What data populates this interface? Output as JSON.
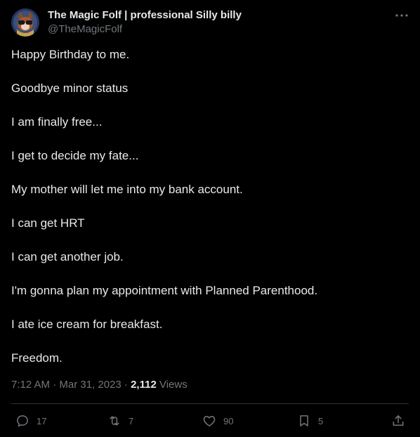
{
  "author": {
    "name": "The Magic Folf | professional Silly billy",
    "handle": "@TheMagicFolf"
  },
  "tweet": {
    "lines": [
      "Happy Birthday to me.",
      "Goodbye minor status",
      "I am finally free...",
      "I get to decide my fate...",
      "My mother will let me into my bank account.",
      "I can get HRT",
      "I can get another job.",
      "I'm gonna plan my appointment with Planned Parenthood.",
      "I ate ice cream for breakfast.",
      "Freedom."
    ],
    "timestamp": "7:12 AM · Mar 31, 2023 · ",
    "views_count": "2,112",
    "views_label": " Views"
  },
  "actions": {
    "replies": "17",
    "reposts": "7",
    "likes": "90",
    "bookmarks": "5"
  },
  "icons": {
    "more": "more-horizontal-icon",
    "reply": "reply-icon",
    "repost": "repost-icon",
    "like": "heart-icon",
    "bookmark": "bookmark-icon",
    "share": "share-icon"
  },
  "colors": {
    "background": "#000000",
    "text": "#e7e9ea",
    "muted": "#71767b",
    "divider": "#2f3336"
  }
}
